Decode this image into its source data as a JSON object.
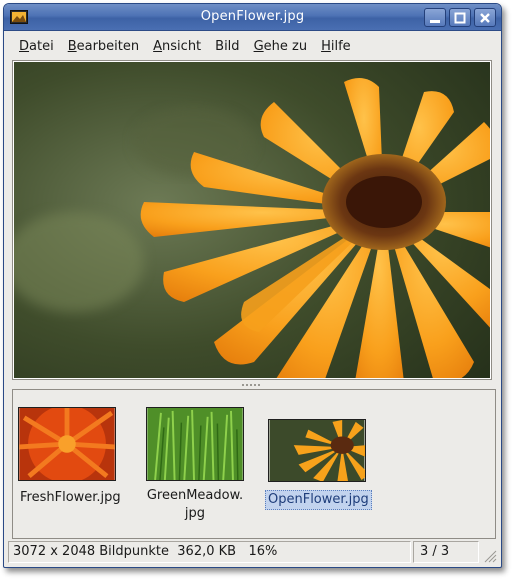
{
  "window": {
    "title": "OpenFlower.jpg"
  },
  "menu": [
    {
      "pre": "",
      "u": "D",
      "post": "atei"
    },
    {
      "pre": "",
      "u": "B",
      "post": "earbeiten"
    },
    {
      "pre": "",
      "u": "A",
      "post": "nsicht"
    },
    {
      "pre": "Bild",
      "u": "",
      "post": ""
    },
    {
      "pre": "",
      "u": "G",
      "post": "ehe zu"
    },
    {
      "pre": "",
      "u": "H",
      "post": "ilfe"
    }
  ],
  "thumbnails": [
    {
      "label": "FreshFlower.jpg",
      "selected": false,
      "icon": "fresh-flower-thumbnail"
    },
    {
      "label": "GreenMeadow.",
      "label2": "jpg",
      "selected": false,
      "icon": "green-meadow-thumbnail"
    },
    {
      "label": "OpenFlower.jpg",
      "selected": true,
      "icon": "open-flower-thumbnail"
    }
  ],
  "status": {
    "info": "3072 x 2048 Bildpunkte  362,0 KB   16%",
    "count": "3 / 3"
  },
  "colors": {
    "titlebar": "#4d72b5",
    "selection": "#c2d3ee",
    "petal": "#f7a21b",
    "flower_center": "#5a2a10"
  }
}
